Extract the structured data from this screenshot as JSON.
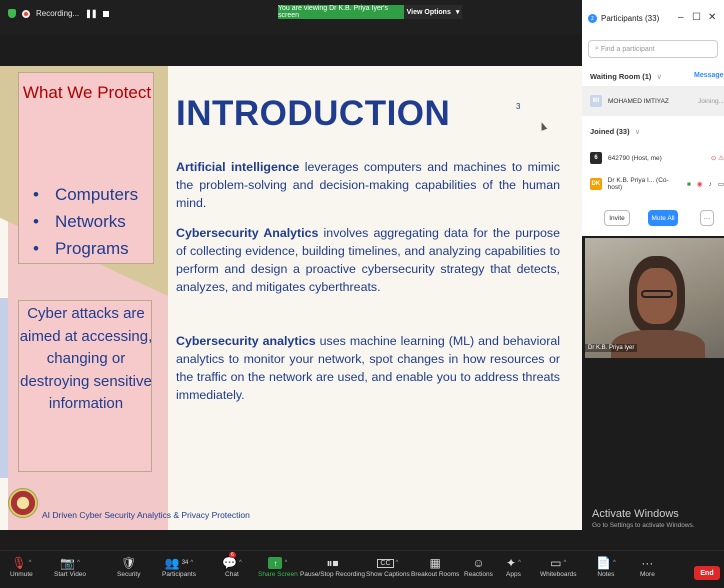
{
  "recording": {
    "label": "Recording..."
  },
  "banner": {
    "viewing": "You are viewing Dr K.B. Priya Iyer's screen",
    "view_options": "View Options",
    "view_options_caret": "▾"
  },
  "slide": {
    "box1": {
      "title": "What We Protect",
      "items": [
        "Computers",
        "Networks",
        "Programs"
      ]
    },
    "box2": {
      "text": "Cyber attacks are aimed at accessing, changing or destroying sensitive information"
    },
    "title": "INTRODUCTION",
    "number": "3",
    "p1": {
      "bold": "Artificial intelligence",
      "rest": " leverages computers and machines to mimic the problem-solving and decision-making capabilities of the human mind."
    },
    "p2": {
      "bold": "Cybersecurity Analytics",
      "rest": " involves aggregating data for the purpose of collecting evidence, building timelines, and analyzing capabilities to perform and design a proactive cybersecurity strategy that detects, analyzes, and mitigates cyberthreats."
    },
    "p3": {
      "bold": "Cybersecurity analytics",
      "rest": " uses machine learning (ML) and behavioral analytics to monitor your network, spot changes in how resources or the traffic on the network are used, and enable you to address threats immediately."
    },
    "footer": "AI Driven Cyber Security Analytics & Privacy Protection"
  },
  "participants": {
    "title": "Participants (33)",
    "search_placeholder": "Find a participant",
    "waiting_room": "Waiting Room (1)",
    "waiting_caret": "∨",
    "message_link": "Message",
    "waiting": {
      "initials": "MI",
      "name": "MOHAMED IMTIYAZ",
      "status": "Joining..."
    },
    "joined": "Joined (33)",
    "joined_caret": "∨",
    "rows": [
      {
        "initials": "6",
        "name": "642790 (Host, me)",
        "avatar_color": "#2b2b2b"
      },
      {
        "initials": "DK",
        "name": "Dr K.B. Priya I... (Co-host)",
        "avatar_color": "#f59f00"
      }
    ],
    "invite": "Invite",
    "mute_all": "Mute All",
    "more": "···"
  },
  "video": {
    "name": "Dr K.B. Priya Iyer"
  },
  "activate": {
    "title": "Activate Windows",
    "sub": "Go to Settings to activate Windows."
  },
  "toolbar": {
    "items": [
      {
        "label": "Unmute",
        "icon": "🎙"
      },
      {
        "label": "Start Video",
        "icon": "📷"
      },
      {
        "label": "Security",
        "icon": "🛡"
      },
      {
        "label": "Participants",
        "icon": "👥",
        "count": "34"
      },
      {
        "label": "Chat",
        "icon": "💬",
        "badge": "6"
      },
      {
        "label": "Share Screen",
        "icon": "↑"
      },
      {
        "label": "Pause/Stop Recording",
        "icon": "⏸⏹"
      },
      {
        "label": "Show Captions",
        "icon": "CC"
      },
      {
        "label": "Breakout Rooms",
        "icon": "▦"
      },
      {
        "label": "Reactions",
        "icon": "☺"
      },
      {
        "label": "Apps",
        "icon": "✦"
      },
      {
        "label": "Whiteboards",
        "icon": "▭"
      },
      {
        "label": "Notes",
        "icon": "📄"
      },
      {
        "label": "More",
        "icon": "···"
      }
    ],
    "end": "End"
  }
}
